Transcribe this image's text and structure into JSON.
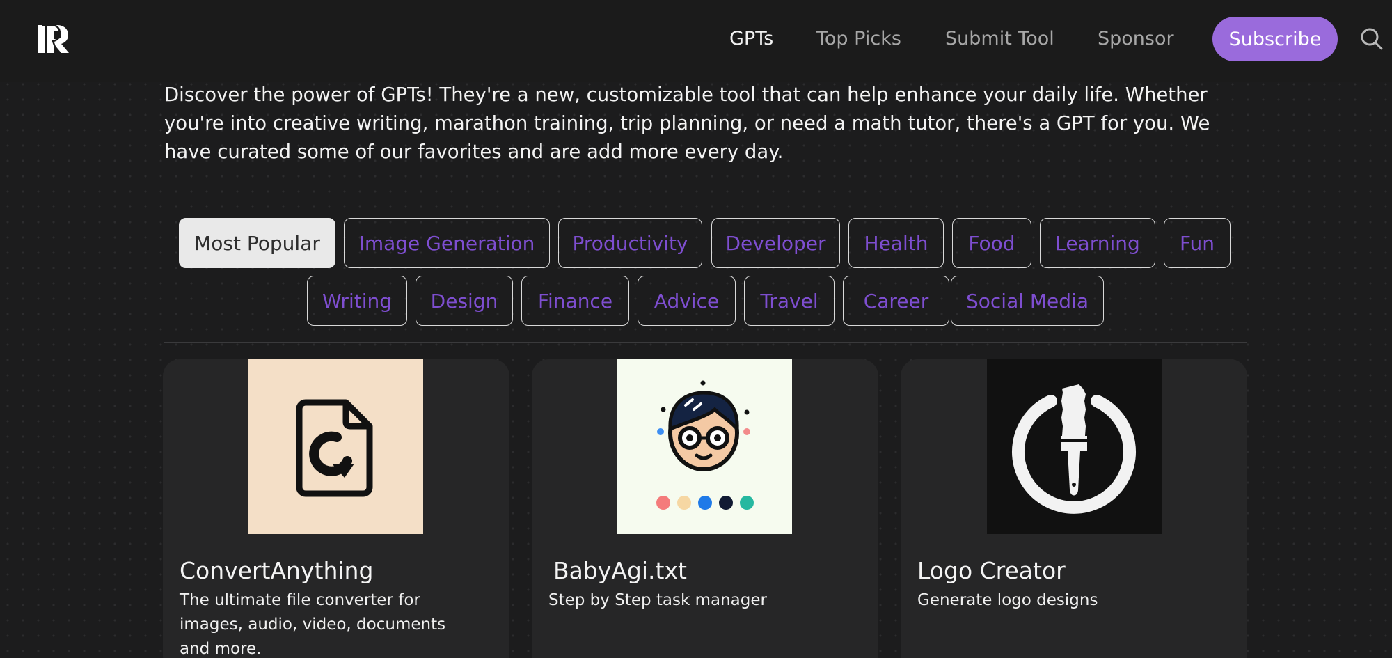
{
  "nav": {
    "links": [
      "GPTs",
      "Top Picks",
      "Submit Tool",
      "Sponsor"
    ],
    "subscribe_label": "Subscribe"
  },
  "intro": "Discover the power of GPTs! They're a new, customizable tool that can help enhance your daily life. Whether you're into creative writing, marathon training, trip planning, or need a math tutor, there's a GPT for you. We have curated some of our favorites and are add more every day.",
  "categories": {
    "row1": [
      "Most Popular",
      "Image Generation",
      "Productivity",
      "Developer",
      "Health",
      "Food",
      "Learning",
      "Fun"
    ],
    "row2": [
      "Writing",
      "Design",
      "Finance",
      "Advice",
      "Travel",
      "Career",
      "Social Media"
    ],
    "active": "Most Popular"
  },
  "cards": [
    {
      "title": "ConvertAnything",
      "description": "The ultimate file converter for images, audio, video, documents and more.",
      "icon": "file-convert-icon"
    },
    {
      "title": "BabyAgi.txt",
      "description": "Step by Step task manager",
      "icon": "boy-with-glasses-icon"
    },
    {
      "title": "Logo Creator",
      "description": "Generate logo designs",
      "icon": "paintbrush-circle-icon"
    }
  ],
  "colors": {
    "accent": "#9a6bdc",
    "tag_text": "#7e4ed0",
    "background": "#1c1c1d",
    "card": "#262627"
  }
}
